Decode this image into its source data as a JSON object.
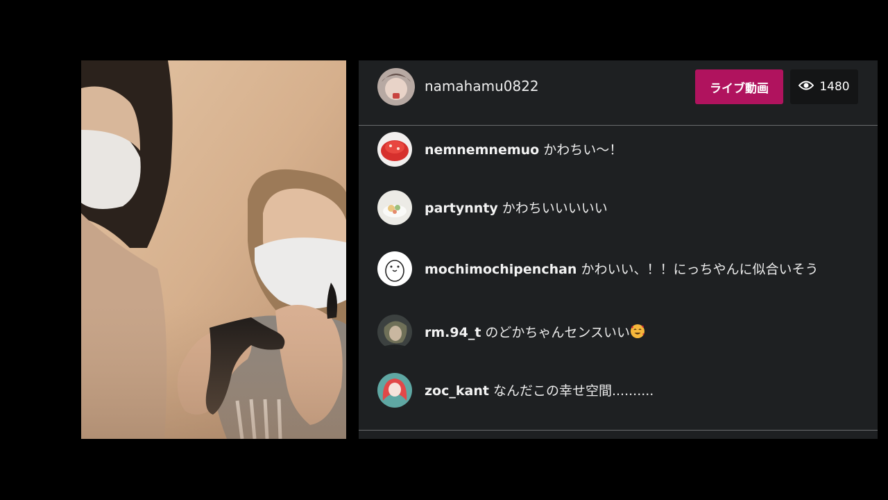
{
  "host": {
    "username": "namahamu0822",
    "avatar": "host-avatar"
  },
  "live_button": {
    "label": "ライブ動画",
    "color": "#b0135e"
  },
  "viewers": {
    "icon": "eye-icon",
    "count": "1480"
  },
  "comments": [
    {
      "user": "nemnemnemuo",
      "text": "かわちい〜！",
      "avatar": "strawberry-cake-avatar"
    },
    {
      "user": "partynnty",
      "text": "かわちいいいいい",
      "avatar": "food-plate-avatar"
    },
    {
      "user": "mochimochipenchan",
      "text": "かわいい、！！にっちやんに似合いそう",
      "avatar": "penguin-drawing-avatar"
    },
    {
      "user": "rm.94_t",
      "text": "のどかちゃんセンスいい",
      "emoji": "smiling-face-with-hearts",
      "avatar": "portrait-avatar"
    },
    {
      "user": "zoc_kant",
      "text": "なんだこの幸せ空間..........",
      "avatar": "red-hair-avatar"
    }
  ],
  "colors": {
    "panel_bg": "#1e2022",
    "divider": "#6a6c6e",
    "page_bg": "#000000"
  }
}
